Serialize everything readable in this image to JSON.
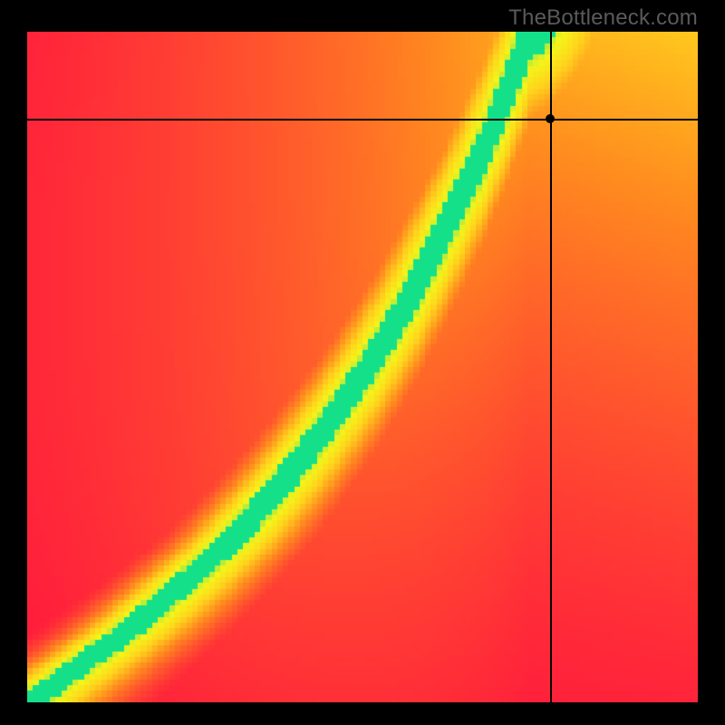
{
  "watermark": "TheBottleneck.com",
  "chart_data": {
    "type": "heatmap",
    "title": "",
    "xlabel": "",
    "ylabel": "",
    "xlim": [
      0,
      100
    ],
    "ylim": [
      0,
      100
    ],
    "marker": {
      "x": 78,
      "y": 87
    },
    "crosshair": {
      "x": 78,
      "y": 87
    },
    "ridge_curve": {
      "description": "Green optimal band centre as (x,y) pairs in 0-100 space",
      "points": [
        [
          0,
          0
        ],
        [
          8,
          6
        ],
        [
          15,
          11
        ],
        [
          22,
          17
        ],
        [
          30,
          24
        ],
        [
          38,
          33
        ],
        [
          45,
          42
        ],
        [
          52,
          52
        ],
        [
          58,
          62
        ],
        [
          63,
          72
        ],
        [
          68,
          82
        ],
        [
          72,
          92
        ],
        [
          75,
          100
        ]
      ],
      "band_width": 6
    },
    "color_stops": [
      {
        "value": 0.0,
        "color": "#ff153e"
      },
      {
        "value": 0.45,
        "color": "#ff8a1f"
      },
      {
        "value": 0.7,
        "color": "#ffd21c"
      },
      {
        "value": 0.88,
        "color": "#f4f41a"
      },
      {
        "value": 0.95,
        "color": "#9fe846"
      },
      {
        "value": 1.0,
        "color": "#14e08a"
      }
    ],
    "value_field": {
      "description": "Approximate heat value at sampled grid points (x,y → 0..1, 1=on green ridge)",
      "samples": [
        {
          "x": 0,
          "y": 0,
          "v": 1.0
        },
        {
          "x": 10,
          "y": 10,
          "v": 0.95
        },
        {
          "x": 20,
          "y": 20,
          "v": 0.9
        },
        {
          "x": 40,
          "y": 40,
          "v": 0.9
        },
        {
          "x": 60,
          "y": 65,
          "v": 0.98
        },
        {
          "x": 70,
          "y": 85,
          "v": 1.0
        },
        {
          "x": 75,
          "y": 100,
          "v": 1.0
        },
        {
          "x": 0,
          "y": 100,
          "v": 0.0
        },
        {
          "x": 100,
          "y": 0,
          "v": 0.05
        },
        {
          "x": 100,
          "y": 100,
          "v": 0.55
        },
        {
          "x": 50,
          "y": 0,
          "v": 0.05
        },
        {
          "x": 0,
          "y": 50,
          "v": 0.0
        },
        {
          "x": 90,
          "y": 50,
          "v": 0.45
        },
        {
          "x": 78,
          "y": 87,
          "v": 0.62
        }
      ]
    }
  }
}
